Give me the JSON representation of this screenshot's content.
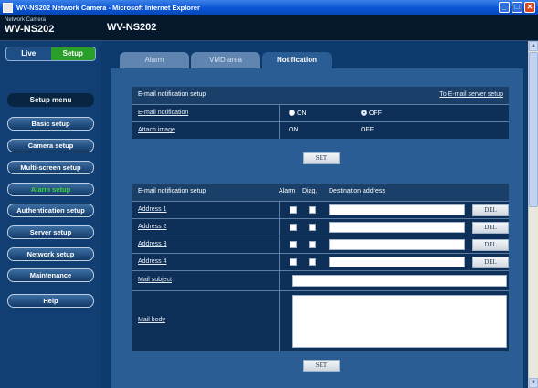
{
  "window": {
    "title": "WV-NS202 Network Camera - Microsoft Internet Explorer",
    "controls": [
      "_",
      "□",
      "✕"
    ]
  },
  "header": {
    "brand_small": "Network Camera",
    "brand_model": "WV-NS202",
    "page_model": "WV-NS202"
  },
  "nav": {
    "live": "Live",
    "setup": "Setup",
    "menu_title": "Setup menu",
    "items": [
      "Basic setup",
      "Camera setup",
      "Multi-screen setup",
      "Alarm setup",
      "Authentication setup",
      "Server setup",
      "Network setup",
      "Maintenance",
      "Help"
    ],
    "active_item": "Alarm setup"
  },
  "tabs": [
    "Alarm",
    "VMD area",
    "Notification"
  ],
  "email_setup": {
    "title": "E-mail notification setup",
    "server_link": "To E-mail server setup",
    "rows": [
      {
        "label": "E-mail notification",
        "on": "ON",
        "off": "OFF",
        "selected": "OFF"
      },
      {
        "label": "Attach image",
        "on": "ON",
        "off": "OFF",
        "selected": "none"
      }
    ],
    "set_label": "SET"
  },
  "address_setup": {
    "title": "E-mail notification setup",
    "col_alarm": "Alarm",
    "col_diag": "Diag.",
    "col_dest": "Destination address",
    "addresses": [
      {
        "label": "Address 1",
        "value": ""
      },
      {
        "label": "Address 2",
        "value": ""
      },
      {
        "label": "Address 3",
        "value": ""
      },
      {
        "label": "Address 4",
        "value": ""
      }
    ],
    "del_label": "DEL",
    "mail_subject": {
      "label": "Mail subject",
      "value": ""
    },
    "mail_body": {
      "label": "Mail body",
      "value": ""
    },
    "set_label": "SET"
  },
  "colors": {
    "nav_bg": "#113e73",
    "active_nav": "#3fd13f",
    "setup_green": "#2a9e2a",
    "panel_bg": "#0e2f57"
  }
}
